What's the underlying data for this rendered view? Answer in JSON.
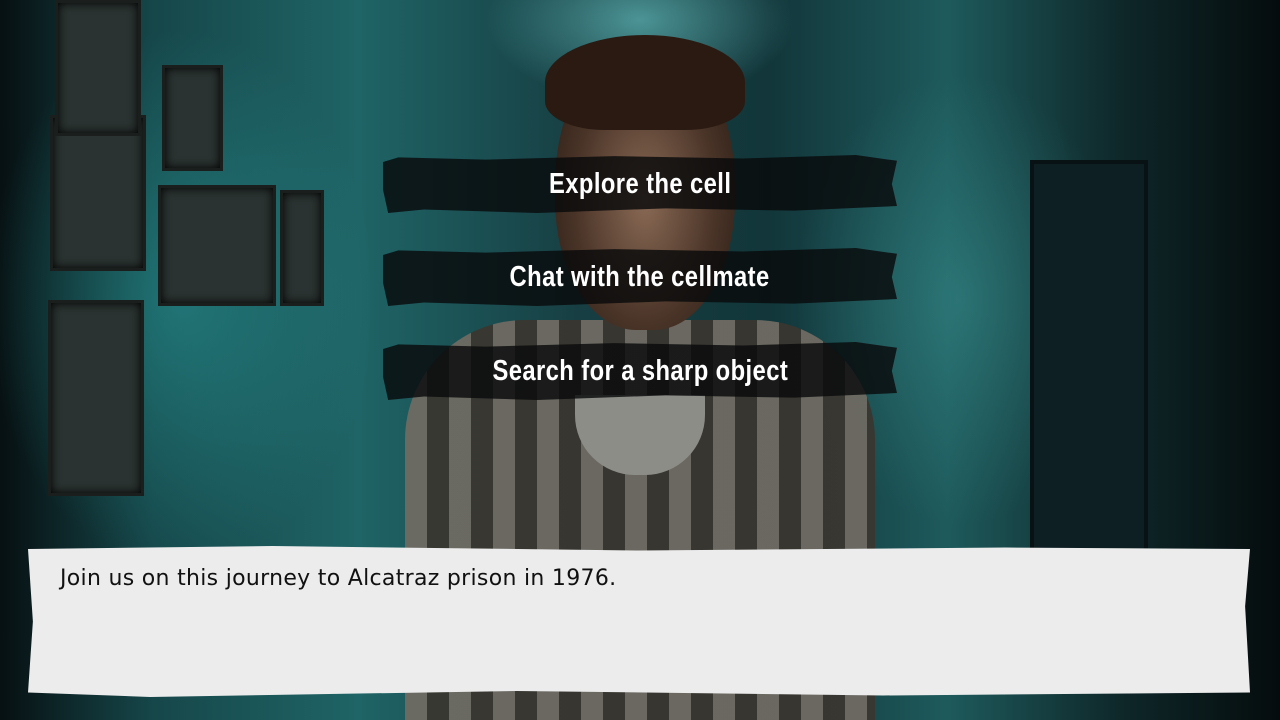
{
  "scene": {
    "background": "Prison cell corridor with inmate in striped uniform"
  },
  "choices": [
    {
      "label": "Explore the cell"
    },
    {
      "label": "Chat with the cellmate"
    },
    {
      "label": "Search for a sharp object"
    }
  ],
  "dialogue": {
    "text": "Join us on this journey to Alcatraz prison in 1976."
  },
  "colors": {
    "choice_bg": "#08090b",
    "dialogue_bg": "#ececec",
    "scene_teal": "#1f6466"
  }
}
